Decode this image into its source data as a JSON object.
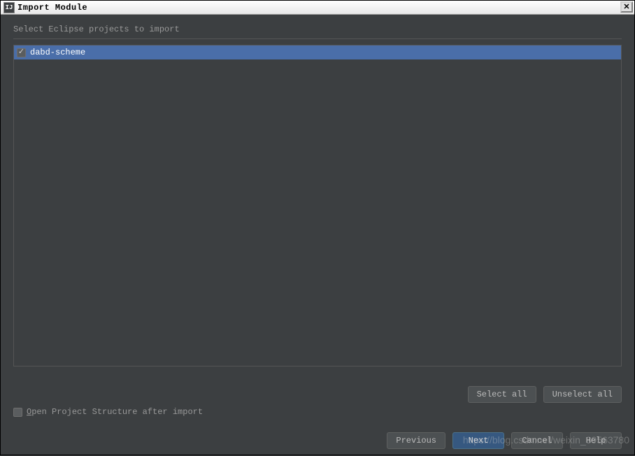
{
  "window": {
    "title": "Import Module",
    "icon_label": "IJ"
  },
  "instruction": "Select Eclipse projects to import",
  "projects": [
    {
      "name": "dabd-scheme",
      "checked": true,
      "selected": true
    }
  ],
  "selection_buttons": {
    "select_all": "Select all",
    "unselect_all": "Unselect all"
  },
  "open_structure": {
    "checked": false,
    "label_prefix": "O",
    "label_rest": "pen Project Structure after import"
  },
  "buttons": {
    "previous": "Previous",
    "next": "Next",
    "cancel": "Cancel",
    "help": "Help"
  },
  "watermark": "https://blog.csdn.net/weixin_39563780"
}
